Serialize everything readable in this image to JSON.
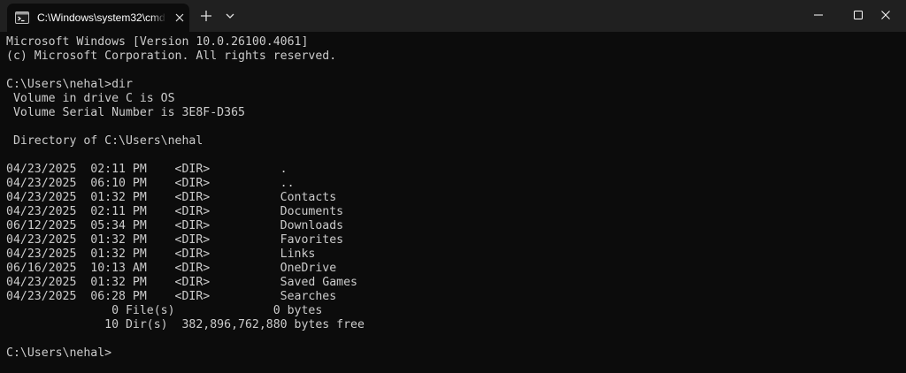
{
  "tab": {
    "title": "C:\\Windows\\system32\\cmd.exe",
    "icon": "terminal-icon"
  },
  "colors": {
    "background": "#0c0c0c",
    "titlebar": "#202020",
    "text": "#cccccc"
  },
  "terminal": {
    "lines": [
      "Microsoft Windows [Version 10.0.26100.4061]",
      "(c) Microsoft Corporation. All rights reserved.",
      "",
      "C:\\Users\\nehal>dir",
      " Volume in drive C is OS",
      " Volume Serial Number is 3E8F-D365",
      "",
      " Directory of C:\\Users\\nehal",
      "",
      "04/23/2025  02:11 PM    <DIR>          .",
      "04/23/2025  06:10 PM    <DIR>          ..",
      "04/23/2025  01:32 PM    <DIR>          Contacts",
      "04/23/2025  02:11 PM    <DIR>          Documents",
      "06/12/2025  05:34 PM    <DIR>          Downloads",
      "04/23/2025  01:32 PM    <DIR>          Favorites",
      "04/23/2025  01:32 PM    <DIR>          Links",
      "06/16/2025  10:13 AM    <DIR>          OneDrive",
      "04/23/2025  01:32 PM    <DIR>          Saved Games",
      "04/23/2025  06:28 PM    <DIR>          Searches",
      "               0 File(s)              0 bytes",
      "              10 Dir(s)  382,896,762,880 bytes free",
      "",
      "C:\\Users\\nehal>"
    ]
  }
}
